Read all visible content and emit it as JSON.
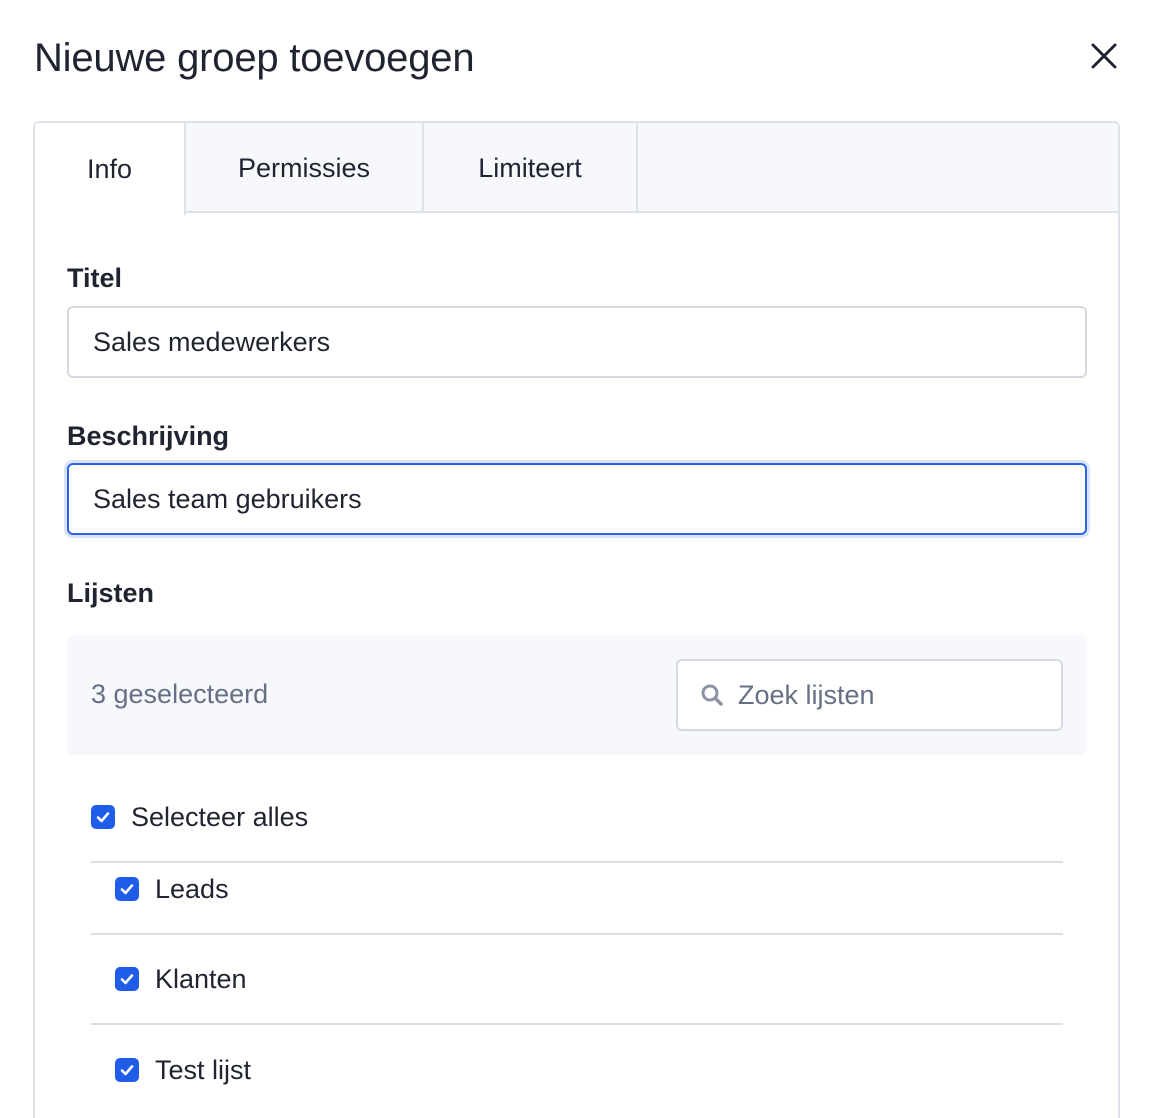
{
  "modal": {
    "title": "Nieuwe groep toevoegen"
  },
  "tabs": [
    {
      "label": "Info",
      "active": true
    },
    {
      "label": "Permissies",
      "active": false
    },
    {
      "label": "Limiteert",
      "active": false
    }
  ],
  "form": {
    "title_label": "Titel",
    "title_value": "Sales medewerkers",
    "description_label": "Beschrijving",
    "description_value": "Sales team gebruikers",
    "lists_label": "Lijsten"
  },
  "lists": {
    "selected_count_text": "3 geselecteerd",
    "search_placeholder": "Zoek lijsten",
    "select_all_label": "Selecteer alles",
    "select_all_checked": true,
    "items": [
      {
        "label": "Leads",
        "checked": true
      },
      {
        "label": "Klanten",
        "checked": true
      },
      {
        "label": "Test lijst",
        "checked": true
      }
    ]
  },
  "colors": {
    "accent": "#1f5de8",
    "focus_border": "#2f63e6",
    "muted_text": "#667085",
    "tab_bar_bg": "#f6f8fc"
  },
  "icons": {
    "close": "close-icon",
    "search": "search-icon",
    "check": "checkmark-icon"
  }
}
